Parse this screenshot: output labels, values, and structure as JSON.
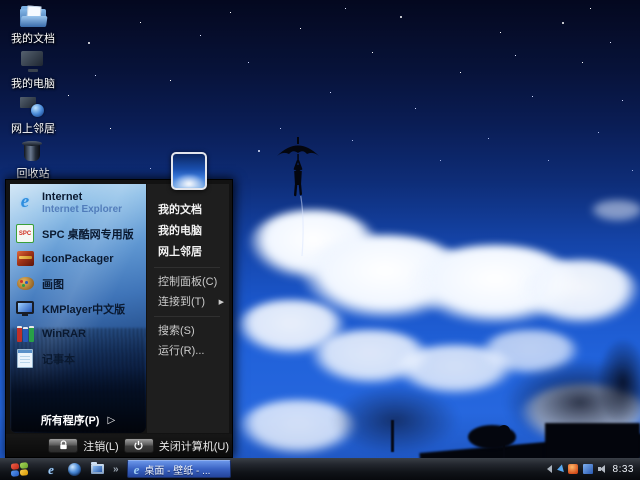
{
  "desktop": {
    "icons": [
      {
        "label": "我的文档",
        "icon": "my-documents-icon"
      },
      {
        "label": "我的电脑",
        "icon": "my-computer-icon"
      },
      {
        "label": "网上邻居",
        "icon": "network-places-icon"
      },
      {
        "label": "回收站",
        "icon": "recycle-bin-icon"
      }
    ]
  },
  "start_menu": {
    "left_items": [
      {
        "label": "Internet",
        "sublabel": "Internet Explorer",
        "icon": "internet-explorer-icon"
      },
      {
        "label": "SPC 桌酷网专用版",
        "icon": "spc-icon"
      },
      {
        "label": "IconPackager",
        "icon": "iconpackager-icon"
      },
      {
        "label": "画图",
        "icon": "paint-icon"
      },
      {
        "label": "KMPlayer中文版",
        "icon": "kmplayer-icon"
      },
      {
        "label": "WinRAR",
        "icon": "winrar-icon"
      },
      {
        "label": "记事本",
        "icon": "notepad-icon"
      }
    ],
    "all_programs": {
      "label": "所有程序(P)"
    },
    "right_items": [
      {
        "label": "我的文档"
      },
      {
        "label": "我的电脑"
      },
      {
        "label": "网上邻居"
      },
      {
        "label": "控制面板(C)"
      },
      {
        "label": "连接到(T)",
        "submenu_arrow": "▶"
      },
      {
        "label": "搜索(S)"
      },
      {
        "label": "运行(R)..."
      }
    ],
    "footer": {
      "logoff": "注销(L)",
      "shutdown": "关闭计算机(U)"
    }
  },
  "taskbar": {
    "quick_launch": [
      {
        "icon": "internet-explorer-icon"
      },
      {
        "icon": "media-player-globe-icon"
      },
      {
        "icon": "folder-icon"
      }
    ],
    "quick_launch_overflow": "»",
    "task_button": {
      "label": "桌面 - 壁纸 - ...",
      "icon": "internet-explorer-icon"
    },
    "tray_icons": [
      {
        "icon": "hide-tray-icons-arrow"
      },
      {
        "icon": "ime-arrow-icon"
      },
      {
        "icon": "security-alert-icon"
      },
      {
        "icon": "windows-update-icon"
      },
      {
        "icon": "volume-icon"
      }
    ],
    "clock": "8:33"
  },
  "glyphs": {
    "ie": "e",
    "spc_label": "SPC",
    "all_programs_arrow": "▷"
  },
  "colors": {
    "sky_top": "#04081f",
    "sky_bright": "#2162da",
    "cloud_white": "#f0f6ff",
    "taskbar_dark": "#0b0d11",
    "menu_panel_dark": "#1e1e1e",
    "task_button_blue": "#3a63c4"
  }
}
